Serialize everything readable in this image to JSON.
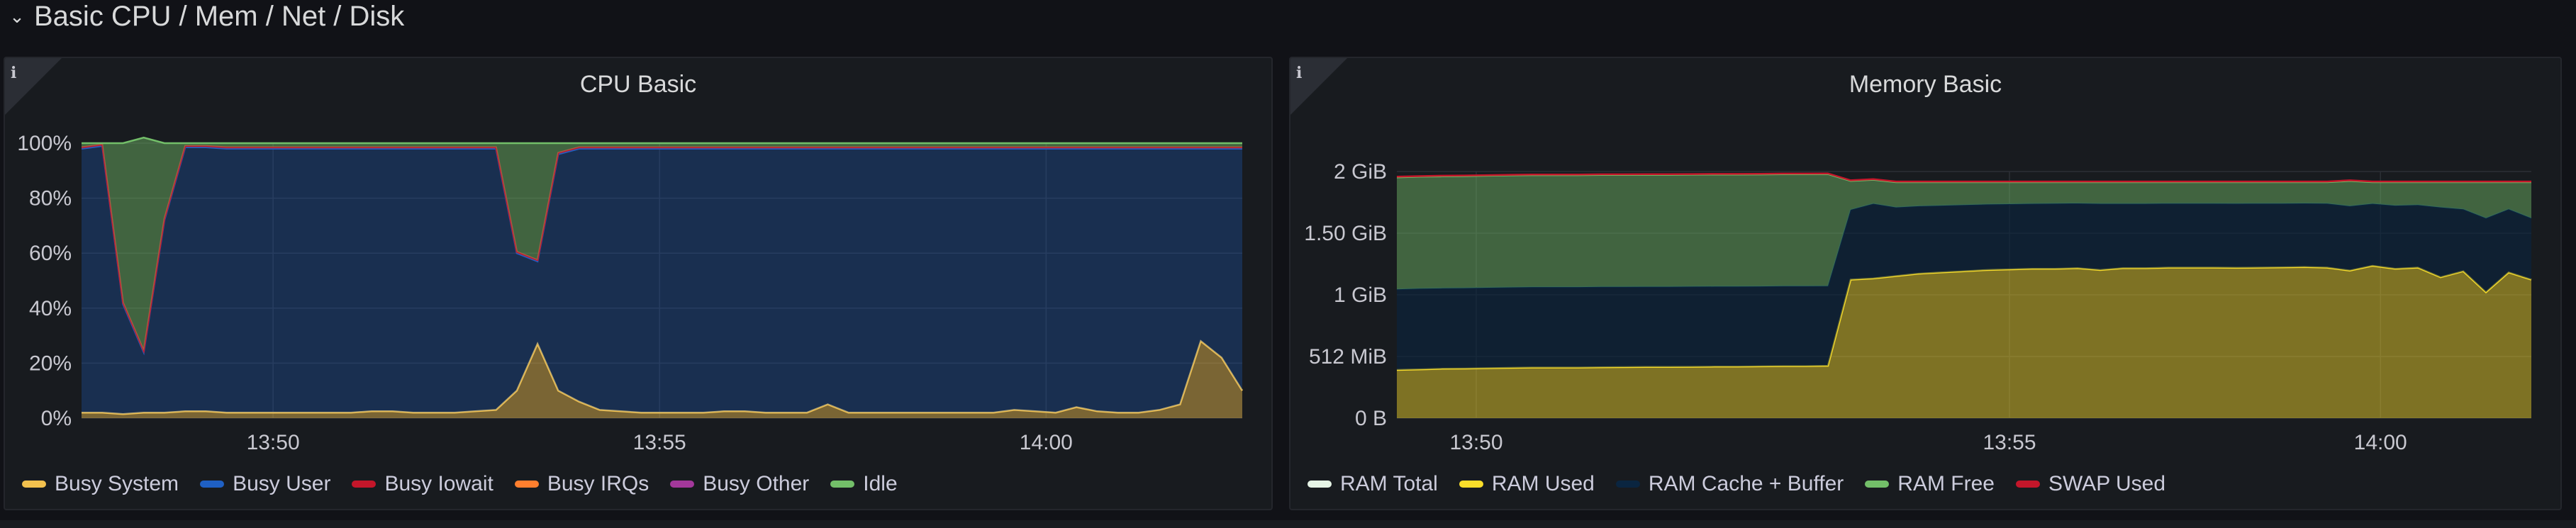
{
  "row": {
    "title": "Basic CPU / Mem / Net / Disk",
    "chevron_icon": "chevron-down-icon"
  },
  "colors": {
    "busy_system": "#f2c14e",
    "busy_user": "#1f60c4",
    "busy_iowait": "#c4162a",
    "busy_irqs": "#ff7f2e",
    "busy_other": "#a3389b",
    "idle": "#73bf69",
    "ram_total": "#e6f4e6",
    "ram_used": "#fade2a",
    "ram_cache": "#0a2540",
    "ram_free": "#73bf69",
    "swap_used": "#c4162a"
  },
  "panels": [
    {
      "title": "CPU Basic",
      "chart_data": {
        "type": "area",
        "yticks": [
          "100%",
          "80%",
          "60%",
          "40%",
          "20%",
          "0%"
        ],
        "ylim": [
          0,
          100
        ],
        "xticks": [
          "13:50",
          "13:55",
          "14:00"
        ],
        "series": [
          {
            "name": "Busy System",
            "values": [
              2,
              2,
              1.5,
              2,
              2,
              2.5,
              2.5,
              2,
              2,
              2,
              2,
              2,
              2,
              2,
              2.5,
              2.5,
              2,
              2,
              2,
              2.5,
              3,
              10,
              27,
              10,
              6,
              3,
              2.5,
              2,
              2,
              2,
              2,
              2.5,
              2.5,
              2,
              2,
              2,
              5,
              2,
              2,
              2,
              2,
              2,
              2,
              2,
              2,
              3,
              2.5,
              2,
              4,
              2.5,
              2,
              2,
              3,
              5,
              28,
              22,
              10
            ]
          },
          {
            "name": "Busy User",
            "values": [
              96,
              97,
              40,
              22,
              70,
              96,
              96,
              96,
              96,
              96,
              96,
              96,
              96,
              96,
              95.5,
              95.5,
              96,
              96,
              96,
              95.5,
              95,
              50,
              30,
              86,
              92,
              95,
              95.5,
              96,
              96,
              96,
              96,
              95.5,
              95.5,
              96,
              96,
              96,
              93,
              96,
              96,
              96,
              96,
              96,
              96,
              96,
              96,
              95,
              95.5,
              96,
              94,
              95.5,
              96,
              96,
              95,
              93,
              70,
              76,
              88
            ]
          },
          {
            "name": "Busy Iowait",
            "values": [
              0.5,
              0.5,
              0.5,
              0.5,
              0.5,
              0.5,
              0.5,
              0.5,
              0.5,
              0.5,
              0.5,
              0.5,
              0.5,
              0.5,
              0.5,
              0.5,
              0.5,
              0.5,
              0.5,
              0.5,
              0.5,
              0.5,
              0.5,
              0.5,
              0.5,
              0.5,
              0.5,
              0.5,
              0.5,
              0.5,
              0.5,
              0.5,
              0.5,
              0.5,
              0.5,
              0.5,
              0.5,
              0.5,
              0.5,
              0.5,
              0.5,
              0.5,
              0.5,
              0.5,
              0.5,
              0.5,
              0.5,
              0.5,
              0.5,
              0.5,
              0.5,
              0.5,
              0.5,
              0.5,
              0.5,
              0.5,
              0.5
            ]
          },
          {
            "name": "Busy IRQs",
            "values": [
              0,
              0,
              0,
              0,
              0,
              0,
              0,
              0,
              0,
              0,
              0,
              0,
              0,
              0,
              0,
              0,
              0,
              0,
              0,
              0,
              0,
              0,
              0,
              0,
              0,
              0,
              0,
              0,
              0,
              0,
              0,
              0,
              0,
              0,
              0,
              0,
              0,
              0,
              0,
              0,
              0,
              0,
              0,
              0,
              0,
              0,
              0,
              0,
              0,
              0,
              0,
              0,
              0,
              0,
              0,
              0,
              0
            ]
          },
          {
            "name": "Busy Other",
            "values": [
              0,
              0,
              0,
              0,
              0,
              0,
              0,
              0,
              0,
              0,
              0,
              0,
              0,
              0,
              0,
              0,
              0,
              0,
              0,
              0,
              0,
              0,
              0,
              0,
              0,
              0,
              0,
              0,
              0,
              0,
              0,
              0,
              0,
              0,
              0,
              0,
              0,
              0,
              0,
              0,
              0,
              0,
              0,
              0,
              0,
              0,
              0,
              0,
              0,
              0,
              0,
              0,
              0,
              0,
              0,
              0,
              0
            ]
          },
          {
            "name": "Idle",
            "values": [
              1.5,
              0.5,
              58,
              77.5,
              27.5,
              1,
              1,
              1.5,
              1.5,
              1.5,
              1.5,
              1.5,
              1.5,
              1.5,
              1.5,
              1.5,
              1.5,
              1.5,
              1.5,
              1.5,
              1.5,
              39.5,
              42.5,
              3.5,
              1.5,
              1.5,
              1.5,
              1.5,
              1.5,
              1.5,
              1.5,
              1.5,
              1.5,
              1.5,
              1.5,
              1.5,
              1.5,
              1.5,
              1.5,
              1.5,
              1.5,
              1.5,
              1.5,
              1.5,
              1.5,
              1.5,
              1.5,
              1.5,
              1.5,
              1.5,
              1.5,
              1.5,
              1.5,
              1.5,
              1.5,
              1.5,
              1.5
            ]
          }
        ]
      },
      "legend": [
        "Busy System",
        "Busy User",
        "Busy Iowait",
        "Busy IRQs",
        "Busy Other",
        "Idle"
      ]
    },
    {
      "title": "Memory Basic",
      "chart_data": {
        "type": "area",
        "yticks": [
          "2 GiB",
          "1.50 GiB",
          "1 GiB",
          "512 MiB",
          "0 B"
        ],
        "ylim": [
          0,
          2048
        ],
        "xticks": [
          "13:50",
          "13:55",
          "14:00"
        ],
        "series": [
          {
            "name": "RAM Total",
            "values": [
              1990,
              1990,
              1990,
              1990,
              1990,
              1990,
              1990,
              1990,
              1990,
              1990,
              1990,
              1990,
              1990,
              1990,
              1990,
              1990,
              1990,
              1990,
              1990,
              1990,
              1990,
              1990,
              1990,
              1990,
              1990,
              1990,
              1990,
              1990,
              1990,
              1990,
              1990,
              1990,
              1990,
              1990,
              1990,
              1990,
              1990,
              1990,
              1990,
              1990,
              1990,
              1990,
              1990,
              1990,
              1990,
              1990,
              1990,
              1990,
              1990,
              1990,
              1990
            ]
          },
          {
            "name": "RAM Used",
            "values": [
              400,
              405,
              410,
              412,
              415,
              418,
              420,
              420,
              420,
              422,
              424,
              425,
              425,
              426,
              428,
              428,
              430,
              432,
              432,
              435,
              1150,
              1160,
              1180,
              1200,
              1210,
              1220,
              1230,
              1235,
              1240,
              1240,
              1245,
              1230,
              1245,
              1245,
              1250,
              1250,
              1250,
              1248,
              1250,
              1252,
              1255,
              1250,
              1225,
              1265,
              1240,
              1250,
              1170,
              1220,
              1045,
              1210,
              1150
            ]
          },
          {
            "name": "RAM Cache + Buffer",
            "values": [
              670,
              670,
              668,
              668,
              668,
              668,
              668,
              668,
              668,
              668,
              666,
              666,
              666,
              666,
              665,
              665,
              664,
              664,
              664,
              662,
              580,
              620,
              570,
              560,
              555,
              550,
              545,
              542,
              540,
              542,
              538,
              550,
              535,
              535,
              532,
              532,
              532,
              533,
              532,
              530,
              528,
              532,
              535,
              515,
              525,
              520,
              580,
              515,
              615,
              525,
              510
            ]
          },
          {
            "name": "RAM Free",
            "values": [
              930,
              930,
              930,
              930,
              930,
              930,
              930,
              930,
              930,
              930,
              930,
              930,
              930,
              930,
              930,
              930,
              930,
              930,
              930,
              930,
              240,
              200,
              210,
              200,
              195,
              190,
              185,
              183,
              180,
              178,
              177,
              180,
              180,
              180,
              178,
              178,
              178,
              179,
              178,
              178,
              177,
              178,
              210,
              180,
              195,
              190,
              210,
              225,
              300,
              225,
              300
            ]
          },
          {
            "name": "SWAP Used",
            "values": [
              5,
              5,
              5,
              5,
              5,
              5,
              5,
              5,
              5,
              5,
              5,
              5,
              5,
              5,
              5,
              5,
              5,
              5,
              5,
              5,
              5,
              5,
              5,
              5,
              5,
              5,
              5,
              5,
              5,
              5,
              5,
              5,
              5,
              5,
              5,
              5,
              5,
              5,
              5,
              5,
              5,
              5,
              5,
              5,
              5,
              5,
              5,
              5,
              5,
              5,
              5
            ]
          }
        ]
      },
      "legend": [
        "RAM Total",
        "RAM Used",
        "RAM Cache + Buffer",
        "RAM Free",
        "SWAP Used"
      ]
    }
  ]
}
